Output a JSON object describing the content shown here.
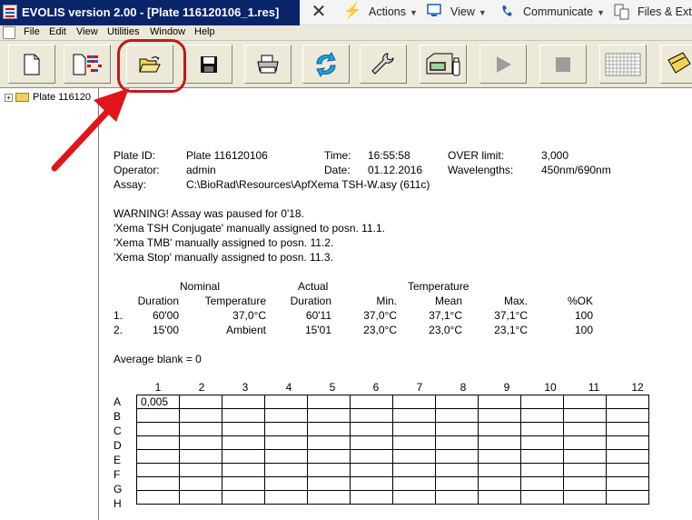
{
  "window": {
    "title": "EVOLIS version 2.00 - [Plate 116120106_1.res]"
  },
  "right_bar": {
    "close_glyph": "✕",
    "actions": "Actions",
    "view": "View",
    "communicate": "Communicate",
    "files": "Files & Extr",
    "icons": [
      "close-icon",
      "lightning-icon",
      "view-icon",
      "communicate-icon",
      "files-icon"
    ]
  },
  "menu": {
    "items": [
      "File",
      "Edit",
      "View",
      "Utilities",
      "Window",
      "Help"
    ]
  },
  "toolbar": {
    "buttons": [
      "new-doc",
      "new-plate-layout",
      "open-folder",
      "save",
      "print",
      "refresh",
      "wrench",
      "reader",
      "play",
      "stop",
      "plate-grid",
      "folder-yellow"
    ]
  },
  "tree": {
    "expander": "+",
    "node_label": "Plate 116120"
  },
  "report": {
    "plate_id_label": "Plate ID:",
    "plate_id": "Plate 116120106",
    "time_label": "Time:",
    "time": "16:55:58",
    "over_label": "OVER limit:",
    "over": "3,000",
    "operator_label": "Operator:",
    "operator": "admin",
    "date_label": "Date:",
    "date": "01.12.2016",
    "wavelengths_label": "Wavelengths:",
    "wavelengths": "450nm/690nm",
    "assay_label": "Assay:",
    "assay": "C:\\BioRad\\Resources\\ApfXema TSH-W.asy (611c)",
    "messages": [
      "WARNING! Assay was paused for 0'18.",
      "'Xema TSH Conjugate' manually assigned to posn. 11.1.",
      "'Xema TMB' manually assigned to posn. 11.2.",
      "'Xema Stop' manually assigned to posn. 11.3."
    ],
    "group_headers": {
      "nominal": "Nominal",
      "actual": "Actual",
      "temperature": "Temperature"
    },
    "col_headers": {
      "duration": "Duration",
      "temperature": "Temperature",
      "actual_duration": "Duration",
      "min": "Min.",
      "mean": "Mean",
      "max": "Max.",
      "ok": "%OK"
    },
    "steps": [
      {
        "n": "1.",
        "nom_dur": "60'00",
        "nom_temp": "37,0°C",
        "act_dur": "60'11",
        "min": "37,0°C",
        "mean": "37,1°C",
        "max": "37,1°C",
        "ok": "100"
      },
      {
        "n": "2.",
        "nom_dur": "15'00",
        "nom_temp": "Ambient",
        "act_dur": "15'01",
        "min": "23,0°C",
        "mean": "23,0°C",
        "max": "23,1°C",
        "ok": "100"
      }
    ],
    "average_blank": "Average blank = 0",
    "plate": {
      "columns": [
        "1",
        "2",
        "3",
        "4",
        "5",
        "6",
        "7",
        "8",
        "9",
        "10",
        "11",
        "12"
      ],
      "rows": [
        "A",
        "B",
        "C",
        "D",
        "E",
        "F",
        "G",
        "H"
      ],
      "a1_value": "0,005"
    }
  }
}
